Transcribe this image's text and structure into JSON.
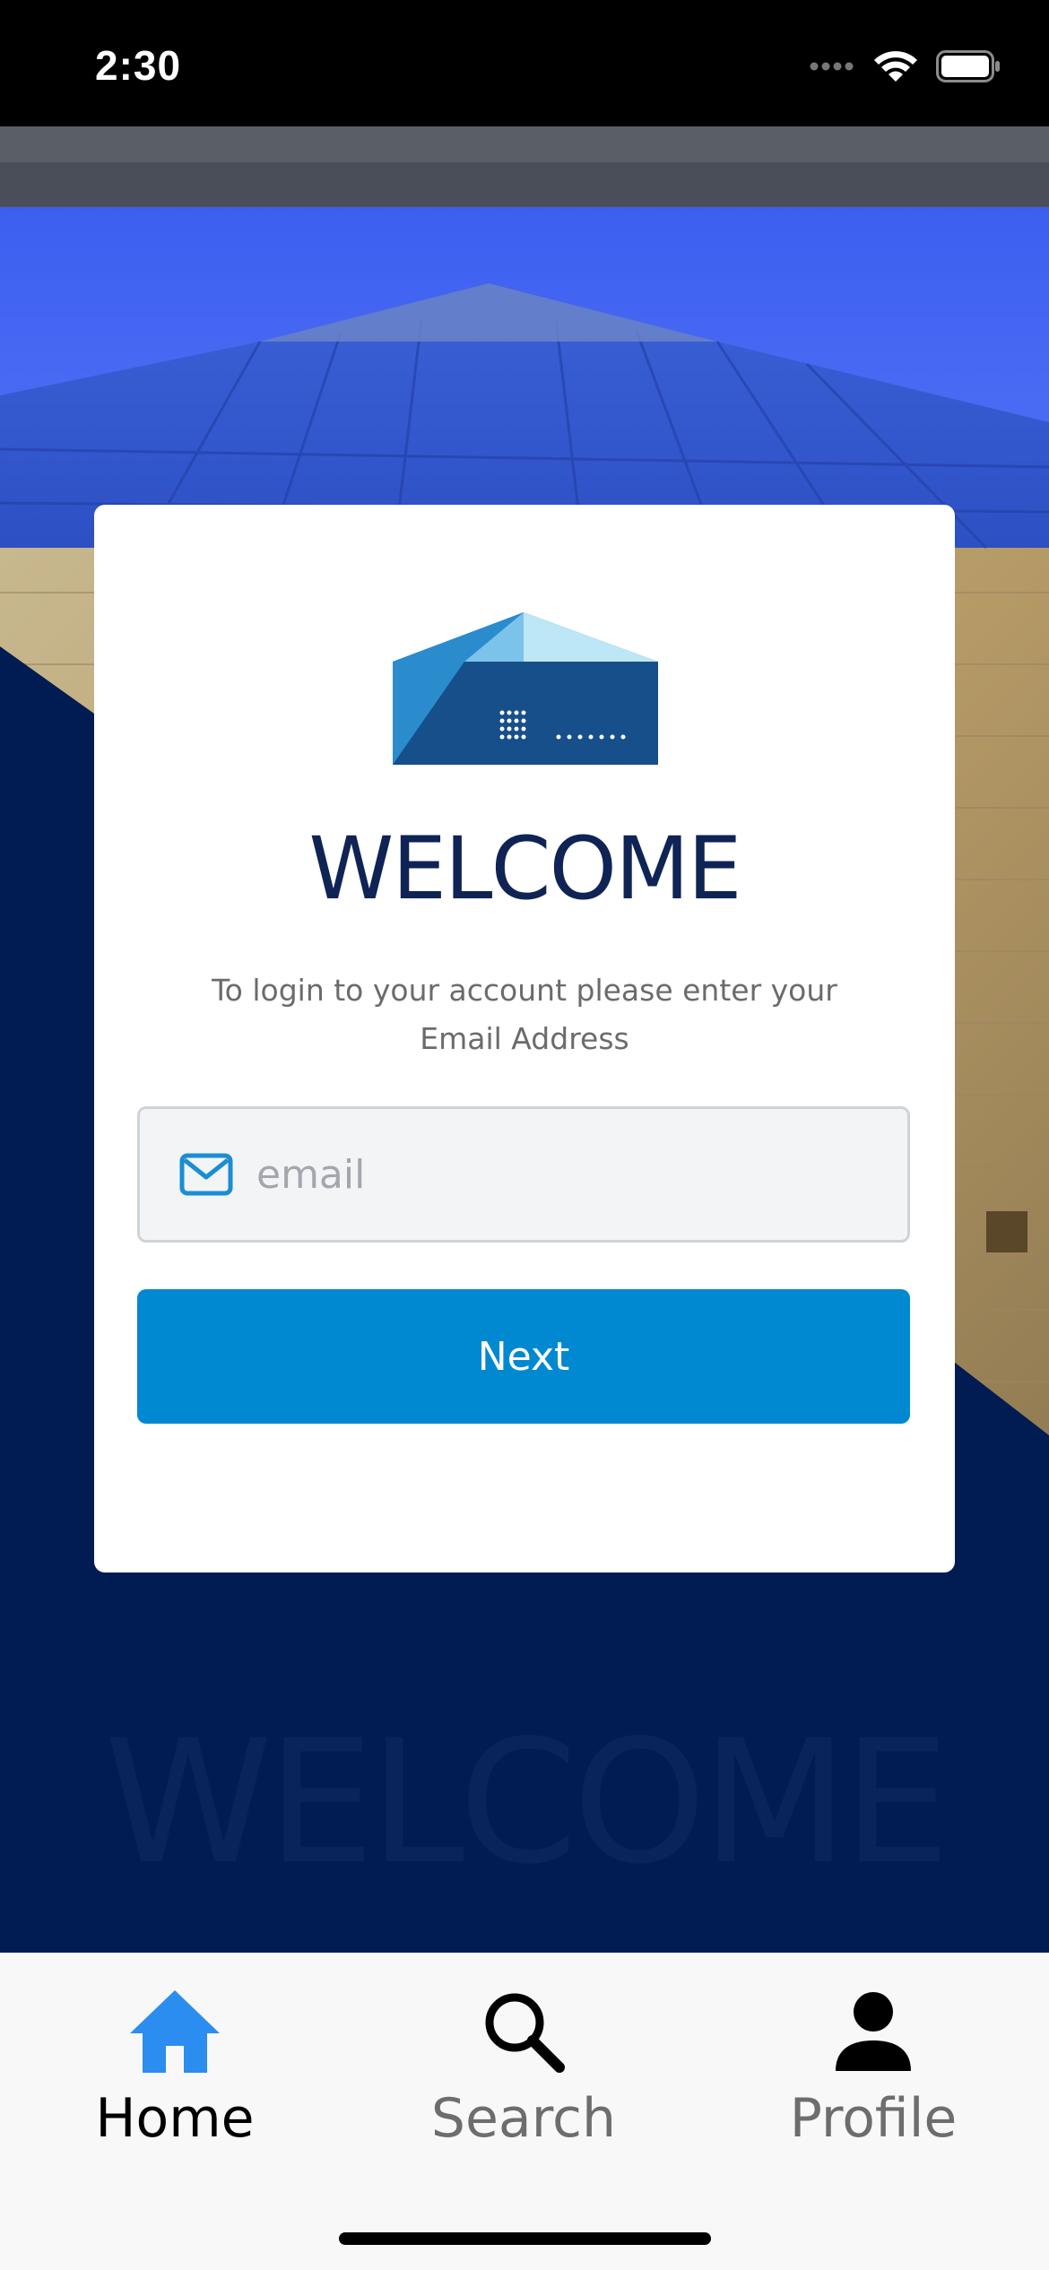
{
  "status_bar": {
    "time": "2:30",
    "icons": [
      "cellular-signal-icon",
      "wifi-icon",
      "battery-icon"
    ]
  },
  "login_card": {
    "logo_icon": "building-logo-icon",
    "title": "WELCOME",
    "subtitle_line1": "To login to your account please enter your",
    "subtitle_line2": "Email Address",
    "email_field": {
      "icon": "mail-icon",
      "placeholder": "email",
      "value": ""
    },
    "next_label": "Next"
  },
  "background": {
    "watermark_text": "WELCOME"
  },
  "tab_bar": {
    "items": [
      {
        "label": "Home",
        "icon": "home-icon",
        "active": true
      },
      {
        "label": "Search",
        "icon": "search-icon",
        "active": false
      },
      {
        "label": "Profile",
        "icon": "person-icon",
        "active": false
      }
    ]
  },
  "colors": {
    "accent": "#0089d1",
    "navy": "#001c52",
    "title": "#0f2355",
    "tab_active": "#2b8def",
    "tab_inactive": "#6d6d6d"
  }
}
